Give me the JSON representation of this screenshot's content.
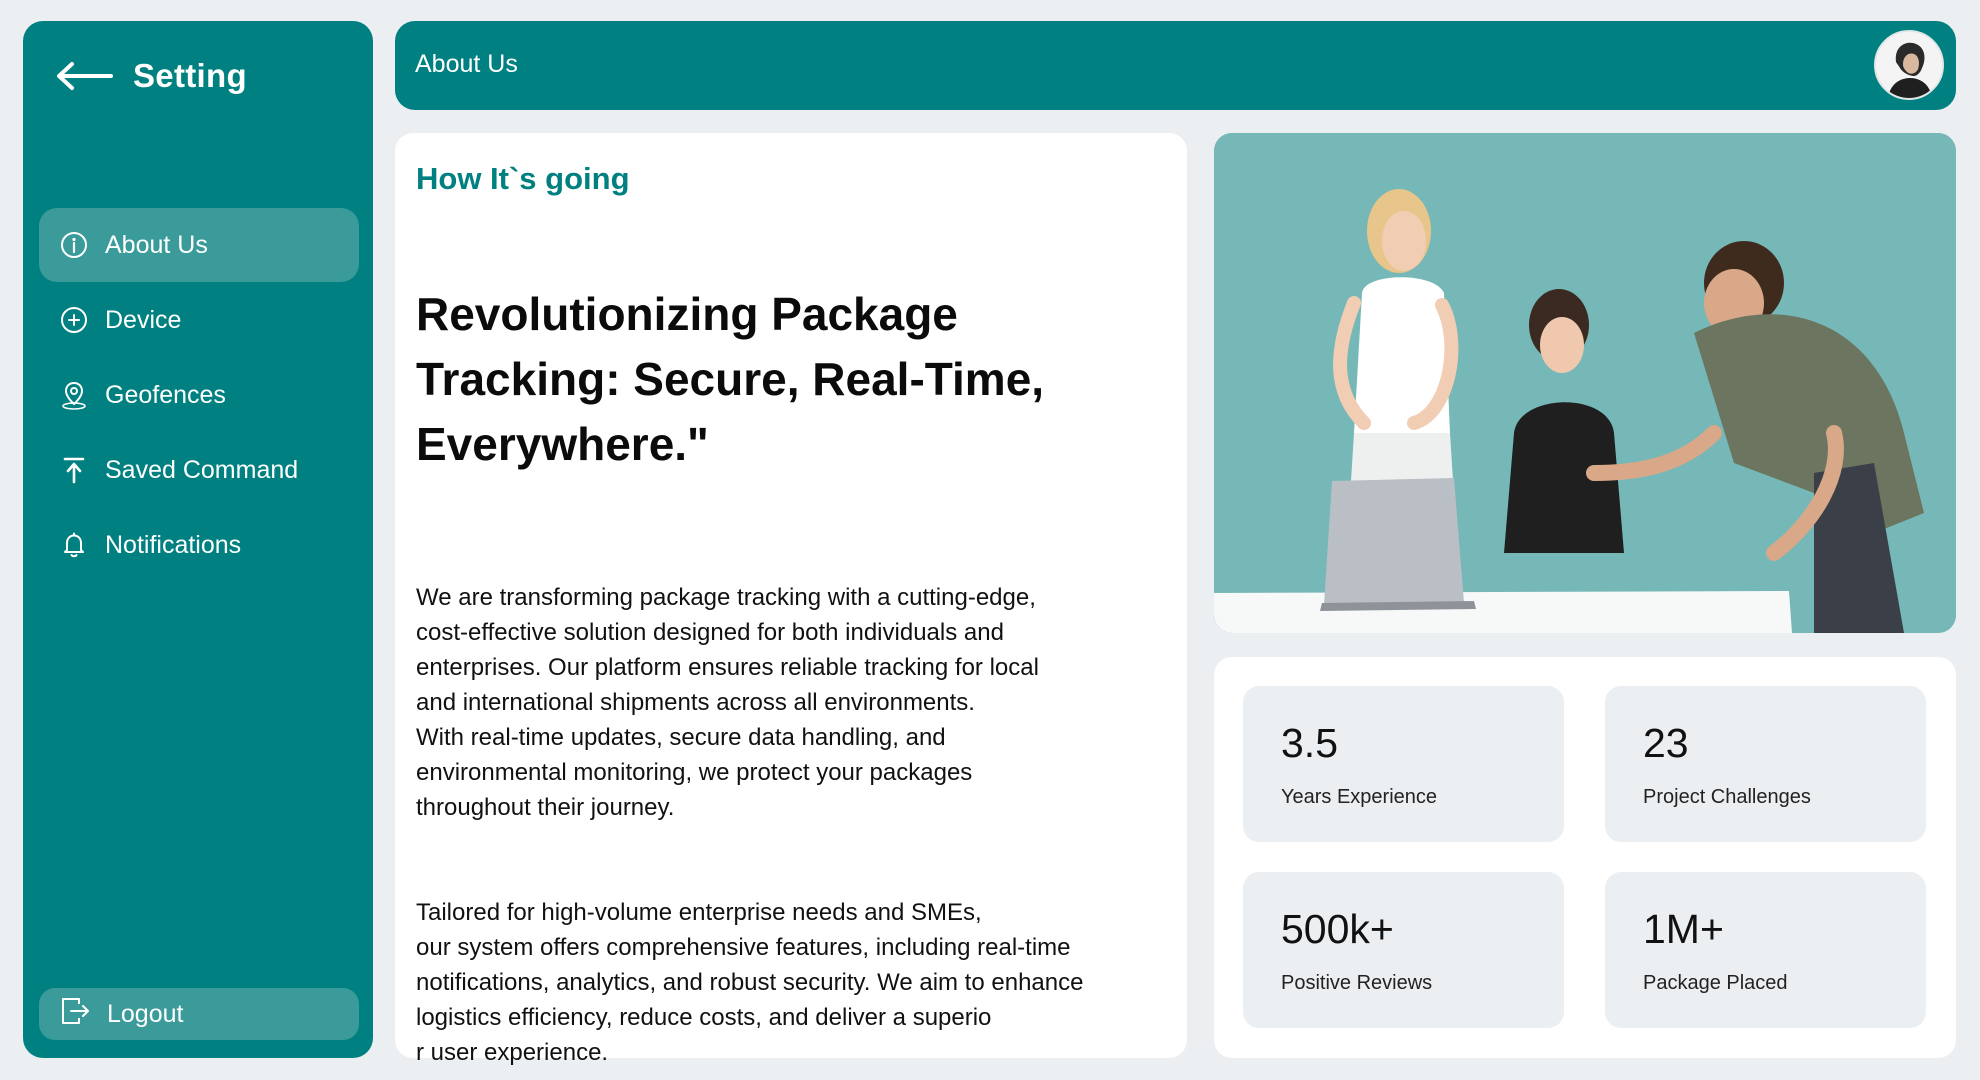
{
  "sidebar": {
    "title": "Setting",
    "items": [
      {
        "label": "About Us",
        "icon": "info-icon",
        "active": true
      },
      {
        "label": "Device",
        "icon": "plus-circle-icon"
      },
      {
        "label": "Geofences",
        "icon": "location-pin-icon"
      },
      {
        "label": "Saved Command",
        "icon": "upload-arrow-icon"
      },
      {
        "label": "Notifications",
        "icon": "bell-icon"
      }
    ],
    "logout_label": "Logout"
  },
  "header": {
    "title": "About Us",
    "avatar_icon": "user-avatar"
  },
  "main": {
    "kicker": "How It`s going",
    "headline": "Revolutionizing Package Tracking: Secure, Real-Time, Everywhere.\"",
    "paragraph1": "We are transforming package tracking with a cutting-edge,\ncost-effective solution designed for both individuals and\nenterprises. Our platform ensures reliable tracking for local\nand international shipments across all environments.\nWith real-time updates, secure data handling, and\nenvironmental monitoring, we protect your packages\nthroughout their journey.",
    "paragraph2": "Tailored for high-volume enterprise needs and SMEs,\nour system offers comprehensive features, including real-time\nnotifications, analytics, and robust security. We aim to enhance\nlogistics efficiency, reduce costs, and deliver a superio\nr user experience."
  },
  "stats": [
    {
      "value": "3.5",
      "label": "Years Experience"
    },
    {
      "value": "23",
      "label": "Project Challenges"
    },
    {
      "value": "500k+",
      "label": "Positive Reviews"
    },
    {
      "value": "1M+",
      "label": "Package Placed"
    }
  ],
  "colors": {
    "primary": "#008080",
    "active_item": "#3a9b9a",
    "background": "#eceff2",
    "hero_bg": "#76b7b7"
  }
}
